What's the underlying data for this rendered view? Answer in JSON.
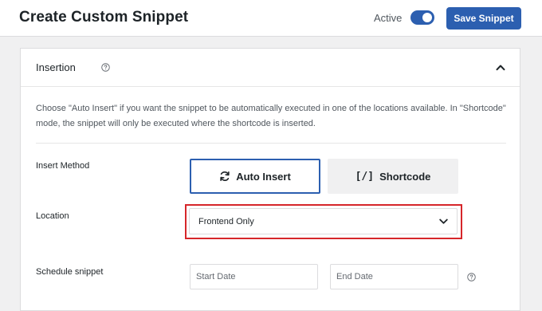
{
  "header": {
    "title": "Create Custom Snippet",
    "active_label": "Active",
    "active_toggle_on": true,
    "save_label": "Save Snippet"
  },
  "section": {
    "title": "Insertion",
    "title_help_icon": "question-circle-icon",
    "collapse_icon": "chevron-up-icon",
    "description": "Choose \"Auto Insert\" if you want the snippet to be automatically executed in one of the locations available. In \"Shortcode\" mode, the snippet will only be executed where the shortcode is inserted."
  },
  "insert_method": {
    "label": "Insert Method",
    "options": [
      {
        "label": "Auto Insert",
        "icon": "refresh-icon",
        "selected": true
      },
      {
        "label": "Shortcode",
        "icon": "[/]",
        "selected": false
      }
    ]
  },
  "location": {
    "label": "Location",
    "value": "Frontend Only",
    "chevron_icon": "chevron-down-icon",
    "highlight_color": "#d6262a"
  },
  "schedule": {
    "label": "Schedule snippet",
    "start_placeholder": "Start Date",
    "end_placeholder": "End Date",
    "help_icon": "question-circle-icon"
  },
  "colors": {
    "accent": "#2c5fb0",
    "highlight": "#d6262a"
  }
}
